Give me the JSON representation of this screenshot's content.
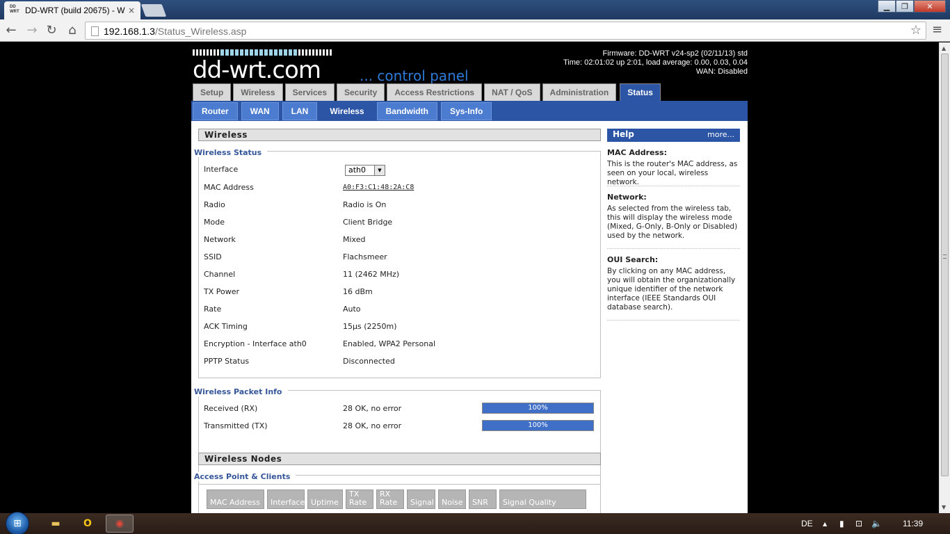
{
  "browser": {
    "tab_title": "DD-WRT (build 20675) - W",
    "tab_favicon": "DD WRT",
    "url_host": "192.168.1.3",
    "url_path": "/Status_Wireless.asp",
    "close_glyph": "×"
  },
  "window_controls": {
    "minimize": "▁",
    "maximize": "❐",
    "close": "✕"
  },
  "header": {
    "logo": "dd-wrt.com",
    "control_panel": "... control panel",
    "firmware": "Firmware: DD-WRT v24-sp2 (02/11/13) std",
    "time": "Time: 02:01:02 up 2:01, load average: 0.00, 0.03, 0.04",
    "wan": "WAN: Disabled"
  },
  "main_tabs": [
    "Setup",
    "Wireless",
    "Services",
    "Security",
    "Access Restrictions",
    "NAT / QoS",
    "Administration",
    "Status"
  ],
  "sub_tabs": [
    "Router",
    "WAN",
    "LAN",
    "Wireless",
    "Bandwidth",
    "Sys-Info"
  ],
  "wireless": {
    "title": "Wireless",
    "status_legend": "Wireless Status",
    "interface_label": "Interface",
    "interface_value": "ath0",
    "rows": [
      {
        "label": "MAC Address",
        "value": "A0:F3:C1:48:2A:C8"
      },
      {
        "label": "Radio",
        "value": "Radio is On"
      },
      {
        "label": "Mode",
        "value": "Client Bridge"
      },
      {
        "label": "Network",
        "value": "Mixed"
      },
      {
        "label": "SSID",
        "value": "Flachsmeer"
      },
      {
        "label": "Channel",
        "value": "11 (2462 MHz)"
      },
      {
        "label": "TX Power",
        "value": "16 dBm"
      },
      {
        "label": "Rate",
        "value": "Auto"
      },
      {
        "label": "ACK Timing",
        "value": "15µs (2250m)"
      },
      {
        "label": "Encryption - Interface ath0",
        "value": "Enabled, WPA2 Personal"
      },
      {
        "label": "PPTP Status",
        "value": "Disconnected"
      }
    ]
  },
  "packet_info": {
    "legend": "Wireless Packet Info",
    "rows": [
      {
        "label": "Received (RX)",
        "value": "28 OK, no error",
        "percent": "100%",
        "fraction": 1.0
      },
      {
        "label": "Transmitted (TX)",
        "value": "28 OK, no error",
        "percent": "100%",
        "fraction": 1.0
      }
    ]
  },
  "nodes": {
    "title": "Wireless Nodes",
    "legend": "Access Point & Clients",
    "columns": [
      "MAC Address",
      "Interface",
      "Uptime",
      "TX Rate",
      "RX Rate",
      "Signal",
      "Noise",
      "SNR",
      "Signal Quality"
    ]
  },
  "help": {
    "title": "Help",
    "more": "more...",
    "items": [
      {
        "title": "MAC Address:",
        "text": "This is the router's MAC address, as seen on your local, wireless network."
      },
      {
        "title": "Network:",
        "text": "As selected from the wireless tab, this will display the wireless mode (Mixed, G-Only, B-Only or Disabled) used by the network."
      },
      {
        "title": "OUI Search:",
        "text": "By clicking on any MAC address, you will obtain the organizationally unique identifier of the network interface (IEEE Standards OUI database search)."
      }
    ]
  },
  "taskbar": {
    "language": "DE",
    "clock": "11:39"
  },
  "colors": {
    "accent_blue": "#2c55a6",
    "link_blue": "#36569a",
    "progress_fill": "#3f6fc6"
  }
}
